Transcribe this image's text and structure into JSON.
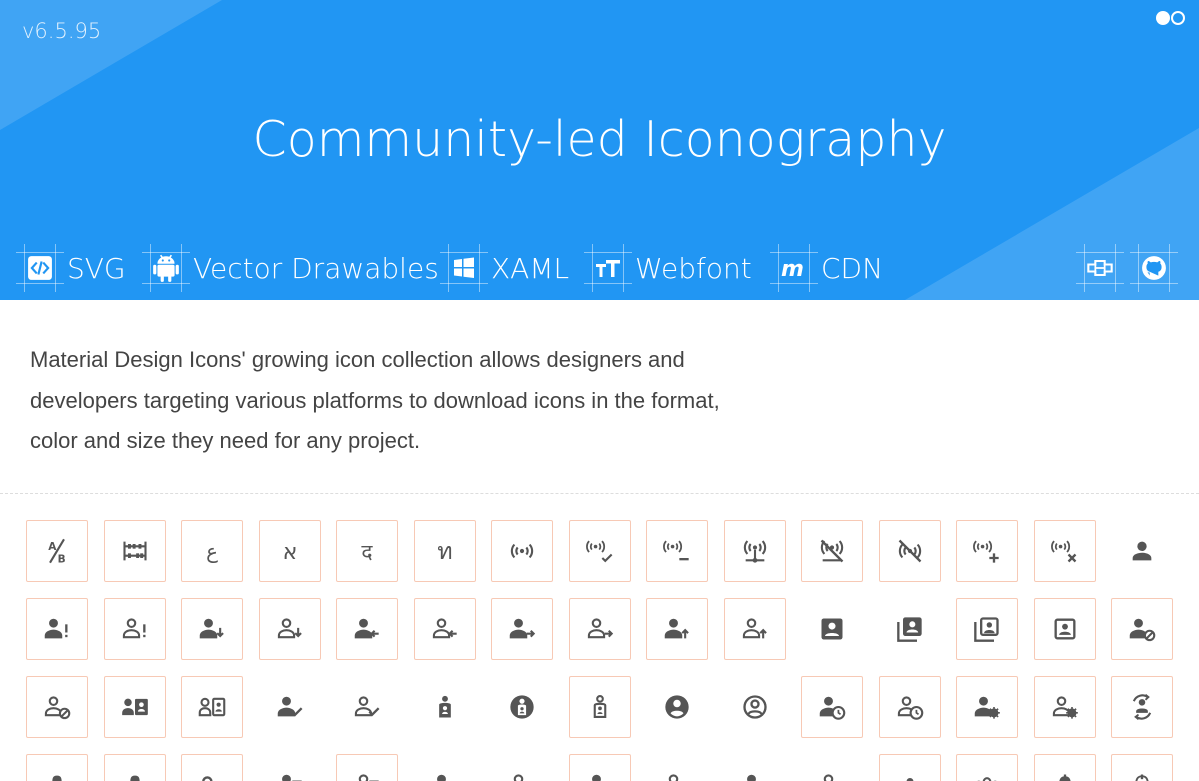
{
  "header": {
    "version": "v6.5.95",
    "headline": "Community-led Iconography",
    "theme_toggle_icon": "toggle-icon",
    "formats": [
      {
        "label": "SVG",
        "icon": "code-icon"
      },
      {
        "label": "Vector Drawables",
        "icon": "android-icon"
      },
      {
        "label": "XAML",
        "icon": "windows-icon"
      },
      {
        "label": "Webfont",
        "icon": "font-icon"
      },
      {
        "label": "CDN",
        "icon": "cdn-icon"
      }
    ],
    "links": [
      {
        "icon": "puzzle-tiles-icon"
      },
      {
        "icon": "github-icon"
      }
    ],
    "colors": {
      "hero": "#2196F3",
      "tile_border": "#f7c9b5",
      "icon": "#555555"
    }
  },
  "intro": {
    "lines": [
      "Material Design Icons' growing icon collection allows designers and",
      "developers targeting various platforms to download icons in the format,",
      "color and size they need for any project."
    ]
  },
  "icon_rows": [
    [
      {
        "icon": "ab-testing-icon",
        "boxed": true
      },
      {
        "icon": "abacus-icon",
        "boxed": true
      },
      {
        "icon": "abjad-arabic-icon",
        "boxed": true
      },
      {
        "icon": "abjad-hebrew-icon",
        "boxed": true
      },
      {
        "icon": "abugida-devanagari-icon",
        "boxed": true
      },
      {
        "icon": "abugida-thai-icon",
        "boxed": true
      },
      {
        "icon": "access-point-icon",
        "boxed": true
      },
      {
        "icon": "access-point-check-icon",
        "boxed": true
      },
      {
        "icon": "access-point-minus-icon",
        "boxed": true
      },
      {
        "icon": "access-point-network-icon",
        "boxed": true
      },
      {
        "icon": "access-point-network-off-icon",
        "boxed": true
      },
      {
        "icon": "access-point-off-icon",
        "boxed": true
      },
      {
        "icon": "access-point-plus-icon",
        "boxed": true
      },
      {
        "icon": "access-point-remove-icon",
        "boxed": true
      },
      {
        "icon": "account-icon",
        "boxed": false
      }
    ],
    [
      {
        "icon": "account-alert-icon",
        "boxed": true
      },
      {
        "icon": "account-alert-outline-icon",
        "boxed": true
      },
      {
        "icon": "account-arrow-down-icon",
        "boxed": true
      },
      {
        "icon": "account-arrow-down-outline-icon",
        "boxed": true
      },
      {
        "icon": "account-arrow-left-icon",
        "boxed": true
      },
      {
        "icon": "account-arrow-left-outline-icon",
        "boxed": true
      },
      {
        "icon": "account-arrow-right-icon",
        "boxed": true
      },
      {
        "icon": "account-arrow-right-outline-icon",
        "boxed": true
      },
      {
        "icon": "account-arrow-up-icon",
        "boxed": true
      },
      {
        "icon": "account-arrow-up-outline-icon",
        "boxed": true
      },
      {
        "icon": "account-box-icon",
        "boxed": false
      },
      {
        "icon": "account-box-multiple-icon",
        "boxed": false
      },
      {
        "icon": "account-box-multiple-outline-icon",
        "boxed": true
      },
      {
        "icon": "account-box-outline-icon",
        "boxed": true
      },
      {
        "icon": "account-cancel-icon",
        "boxed": true
      }
    ],
    [
      {
        "icon": "account-cancel-outline-icon",
        "boxed": true
      },
      {
        "icon": "account-card-icon",
        "boxed": true
      },
      {
        "icon": "account-card-outline-icon",
        "boxed": true
      },
      {
        "icon": "account-check-icon",
        "boxed": false
      },
      {
        "icon": "account-check-outline-icon",
        "boxed": false
      },
      {
        "icon": "account-child-icon",
        "boxed": false
      },
      {
        "icon": "account-child-circle-icon",
        "boxed": false
      },
      {
        "icon": "account-child-outline-icon",
        "boxed": true
      },
      {
        "icon": "account-circle-icon",
        "boxed": false
      },
      {
        "icon": "account-circle-outline-icon",
        "boxed": false
      },
      {
        "icon": "account-clock-icon",
        "boxed": true
      },
      {
        "icon": "account-clock-outline-icon",
        "boxed": true
      },
      {
        "icon": "account-cog-icon",
        "boxed": true
      },
      {
        "icon": "account-cog-outline-icon",
        "boxed": true
      },
      {
        "icon": "account-convert-icon",
        "boxed": true
      }
    ],
    [
      {
        "icon": "account-cowboy-hat-icon",
        "boxed": true
      },
      {
        "icon": "account-cowboy-hat-outline-icon",
        "boxed": true
      },
      {
        "icon": "account-credit-card-icon",
        "boxed": true
      },
      {
        "icon": "account-details-icon",
        "boxed": false
      },
      {
        "icon": "account-details-outline-icon",
        "boxed": true
      },
      {
        "icon": "account-edit-icon",
        "boxed": false
      },
      {
        "icon": "account-edit-outline-icon",
        "boxed": false
      },
      {
        "icon": "account-eye-icon",
        "boxed": true
      },
      {
        "icon": "account-eye-outline-icon",
        "boxed": false
      },
      {
        "icon": "account-filter-icon",
        "boxed": false
      },
      {
        "icon": "account-filter-outline-icon",
        "boxed": false
      },
      {
        "icon": "account-group-icon",
        "boxed": true
      },
      {
        "icon": "account-group-outline-icon",
        "boxed": true
      },
      {
        "icon": "account-hard-hat-icon",
        "boxed": true
      },
      {
        "icon": "account-hard-hat-outline-icon",
        "boxed": true
      }
    ]
  ]
}
